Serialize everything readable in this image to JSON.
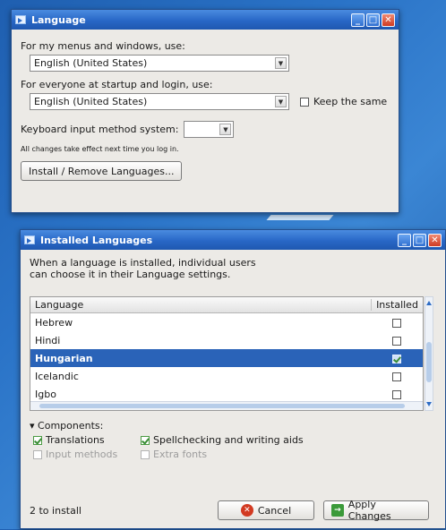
{
  "language_window": {
    "title": "Language",
    "menus_label": "For my menus and windows, use:",
    "menus_value": "English (United States)",
    "everyone_label": "For everyone at startup and login, use:",
    "everyone_value": "English (United States)",
    "keep_same_label": "Keep the same",
    "keep_same_checked": false,
    "input_method_label": "Keyboard input method system:",
    "input_method_value": "",
    "note": "All changes take effect next time you log in.",
    "install_button": "Install / Remove Languages..."
  },
  "installed_window": {
    "title": "Installed Languages",
    "description_line1": "When a language is installed, individual users",
    "description_line2": "can choose it in their Language settings.",
    "columns": {
      "language": "Language",
      "installed": "Installed"
    },
    "rows": [
      {
        "name": "Hebrew",
        "installed": false,
        "selected": false
      },
      {
        "name": "Hindi",
        "installed": false,
        "selected": false
      },
      {
        "name": "Hungarian",
        "installed": true,
        "selected": true
      },
      {
        "name": "Icelandic",
        "installed": false,
        "selected": false
      },
      {
        "name": "Igbo",
        "installed": false,
        "selected": false
      }
    ],
    "components": {
      "header": "Components:",
      "expander": "▾",
      "translations": "Translations",
      "translations_checked": true,
      "spellcheck": "Spellchecking and writing aids",
      "spellcheck_checked": true,
      "input_methods": "Input methods",
      "input_methods_checked": false,
      "extra_fonts": "Extra fonts",
      "extra_fonts_checked": false
    },
    "status": "2 to install",
    "cancel_button": "Cancel",
    "apply_button": "Apply Changes"
  },
  "window_controls": {
    "minimize": "_",
    "maximize": "□",
    "close": "✕"
  }
}
